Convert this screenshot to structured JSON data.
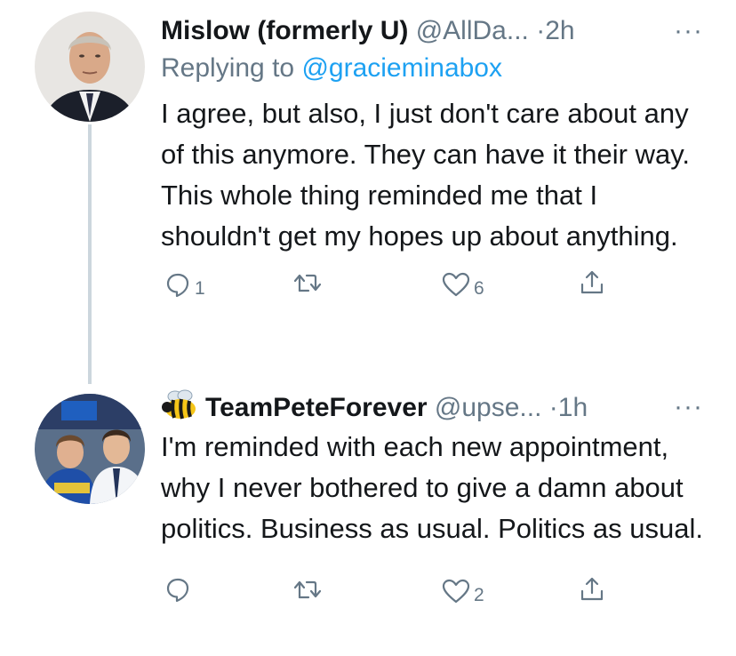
{
  "tweets": [
    {
      "name": "Mislow (formerly U)",
      "handle": "@AllDa...",
      "dot": "·",
      "time": "2h",
      "more": "···",
      "replying_prefix": "Replying to ",
      "replying_mention": "@gracieminabox",
      "body": "I agree, but also, I just don't care about any of this anymore. They can have it their way. This whole thing reminded me that I shouldn't get my hopes up about anything.",
      "actions": {
        "reply_count": "1",
        "retweet_count": "",
        "like_count": "6"
      }
    },
    {
      "name_emoji": "bee",
      "name": "TeamPeteForever",
      "handle": "@upse...",
      "dot": "·",
      "time": "1h",
      "more": "···",
      "body": "I'm reminded with each new appointment, why I never bothered to give a damn about politics. Business as usual. Politics as usual.",
      "actions": {
        "reply_count": "",
        "retweet_count": "",
        "like_count": "2"
      }
    }
  ],
  "colors": {
    "text": "#14171a",
    "secondary": "#657786",
    "link": "#1da1f2",
    "thread_line": "#ccd6dd"
  },
  "icons": [
    "reply-icon",
    "retweet-icon",
    "like-icon",
    "share-icon",
    "more-icon",
    "bee-icon"
  ]
}
